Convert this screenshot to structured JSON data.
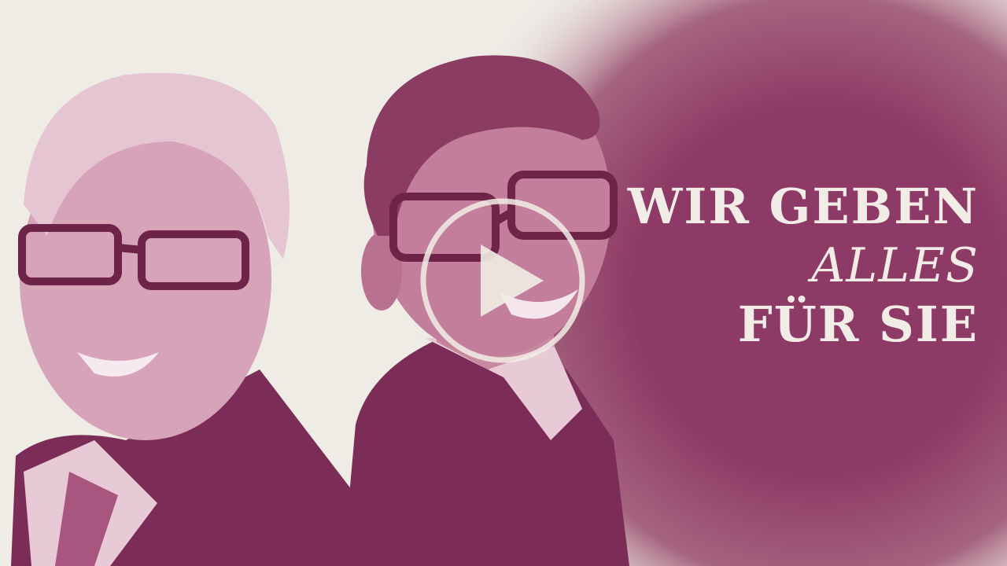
{
  "video": {
    "headline": {
      "line1": "WIR GEBEN",
      "line2": "ALLES",
      "line3": "FÜR SIE"
    },
    "play_icon": "play-icon"
  },
  "colors": {
    "background": "#efece6",
    "accent": "#8e3a66",
    "headline_text": "#f1ede6"
  }
}
